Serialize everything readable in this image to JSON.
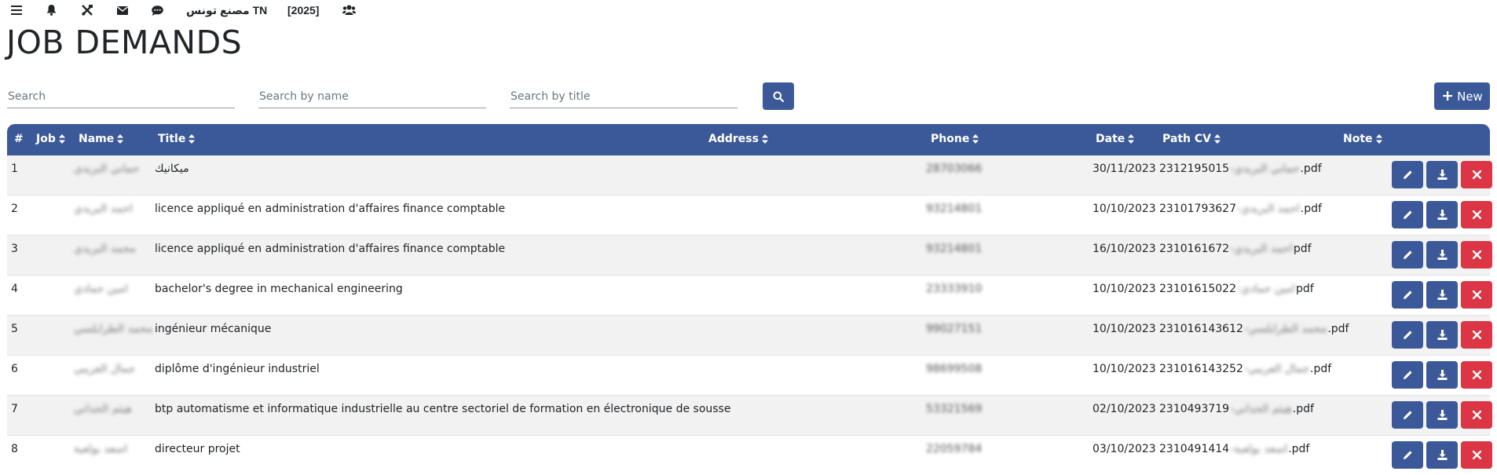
{
  "nav": {
    "icons": [
      "menu-icon",
      "bell-icon",
      "tools-icon",
      "envelope-icon",
      "comment-icon",
      "users-icon"
    ],
    "company": "مصنع تونس TN",
    "year": "[2025]"
  },
  "page_title": "JOB DEMANDS",
  "search": {
    "general_placeholder": "Search",
    "name_placeholder": "Search by name",
    "title_placeholder": "Search by title"
  },
  "new_button": "New",
  "table": {
    "headers": {
      "index": "#",
      "job": "Job",
      "name": "Name",
      "title": "Title",
      "address": "Address",
      "phone": "Phone",
      "date": "Date",
      "path_cv": "Path CV",
      "note": "Note"
    },
    "rows": [
      {
        "index": "1",
        "name": "حماني البريدي",
        "title": "ميكانيك",
        "phone": "28703066",
        "date": "30/11/2023",
        "cv_prefix": "2312195015",
        "cv_name": "-حماني البريدي",
        "cv_ext": ".pdf"
      },
      {
        "index": "2",
        "name": "احمد البريدي",
        "title": "licence appliqué en administration d'affaires finance comptable",
        "phone": "93214801",
        "date": "10/10/2023",
        "cv_prefix": "23101793627",
        "cv_name": "-احمد البريدي",
        "cv_ext": ".pdf"
      },
      {
        "index": "3",
        "name": "محمد البريدي",
        "title": "licence appliqué en administration d'affaires finance comptable",
        "phone": "93214801",
        "date": "16/10/2023",
        "cv_prefix": "2310161672",
        "cv_name": "-احمد البريدي",
        "cv_ext": "pdf"
      },
      {
        "index": "4",
        "name": "امين حمادي",
        "title": "bachelor's degree in mechanical engineering",
        "phone": "23333910",
        "date": "10/10/2023",
        "cv_prefix": "23101615022",
        "cv_name": "-امين حمادي",
        "cv_ext": "pdf"
      },
      {
        "index": "5",
        "name": "محمد الطرابلسي",
        "title": "ingénieur mécanique",
        "phone": "99027151",
        "date": "10/10/2023",
        "cv_prefix": "231016143612",
        "cv_name": "-محمد الطرابلسي",
        "cv_ext": ".pdf"
      },
      {
        "index": "6",
        "name": "جمال العريبي",
        "title": "diplôme d'ingénieur industriel",
        "phone": "98699508",
        "date": "10/10/2023",
        "cv_prefix": "231016143252",
        "cv_name": "-جمال العريبي",
        "cv_ext": ".pdf"
      },
      {
        "index": "7",
        "name": "هيثم الحداني",
        "title": "btp automatisme et informatique industrielle au centre sectoriel de formation en électronique de sousse",
        "phone": "53321569",
        "date": "02/10/2023",
        "cv_prefix": "2310493719",
        "cv_name": "-هيثم الحداني",
        "cv_ext": ".pdf"
      },
      {
        "index": "8",
        "name": "اسعد بولعية",
        "title": "directeur projet",
        "phone": "22059784",
        "date": "03/10/2023",
        "cv_prefix": "2310491414",
        "cv_name": "-اسعد بولعية",
        "cv_ext": ".pdf"
      }
    ]
  },
  "colors": {
    "primary": "#3b5998",
    "danger": "#dc3545",
    "stripe": "#f2f2f2"
  }
}
